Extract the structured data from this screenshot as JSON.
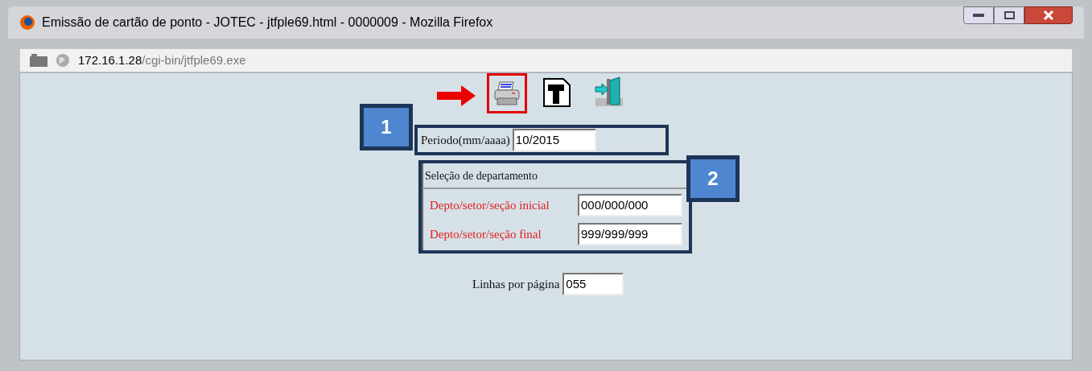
{
  "window": {
    "title": "Emissão de cartão de ponto - JOTEC - jtfple69.html - 0000009 - Mozilla Firefox"
  },
  "address_bar": {
    "host": "172.16.1.28",
    "path": "/cgi-bin/jtfple69.exe"
  },
  "toolbar": [
    {
      "kind": "print",
      "highlighted": true
    },
    {
      "kind": "text",
      "highlighted": false
    },
    {
      "kind": "exit",
      "highlighted": false
    }
  ],
  "period": {
    "label": "Periodo(mm/aaaa)",
    "value": "10/2015"
  },
  "department_selection": {
    "title": "Seleção de departamento",
    "fields": [
      {
        "label": "Depto/setor/seção inicial",
        "value": "000/000/000"
      },
      {
        "label": "Depto/setor/seção final",
        "value": "999/999/999"
      }
    ]
  },
  "lines_per_page": {
    "label": "Linhas por página",
    "value": "055"
  },
  "callouts": [
    "1",
    "2"
  ]
}
